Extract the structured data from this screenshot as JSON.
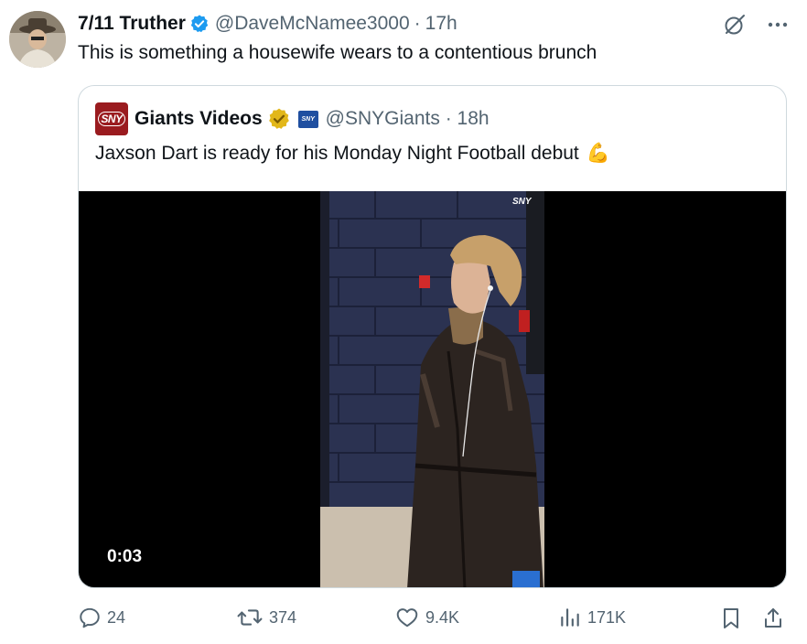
{
  "tweet": {
    "author_name": "7/11 Truther",
    "handle": "@DaveMcNamee3000",
    "separator": "·",
    "time": "17h",
    "text": "This is something a housewife wears to a contentious brunch"
  },
  "quoted": {
    "logo_text": "SNY",
    "author_name": "Giants Videos",
    "mini_logo_text": "SNY",
    "handle": "@SNYGiants",
    "separator": " · ",
    "time": "18h",
    "text": "Jaxson Dart is ready for his Monday Night Football debut",
    "emoji": "💪",
    "video": {
      "watermark": "SNY",
      "duration": "0:03"
    }
  },
  "actions": {
    "replies": "24",
    "reposts": "374",
    "likes": "9.4K",
    "views": "171K"
  },
  "colors": {
    "verified_blue": "#1d9bf0",
    "gold_badge": "#e2b719",
    "sny_red": "#9a1b1f",
    "secondary_text": "#536471",
    "border": "#cfd9de"
  },
  "icons": {
    "grok": "grok-icon",
    "more": "more-icon",
    "reply": "reply-icon",
    "repost": "repost-icon",
    "like": "like-icon",
    "views": "views-icon",
    "bookmark": "bookmark-icon",
    "share": "share-icon"
  }
}
